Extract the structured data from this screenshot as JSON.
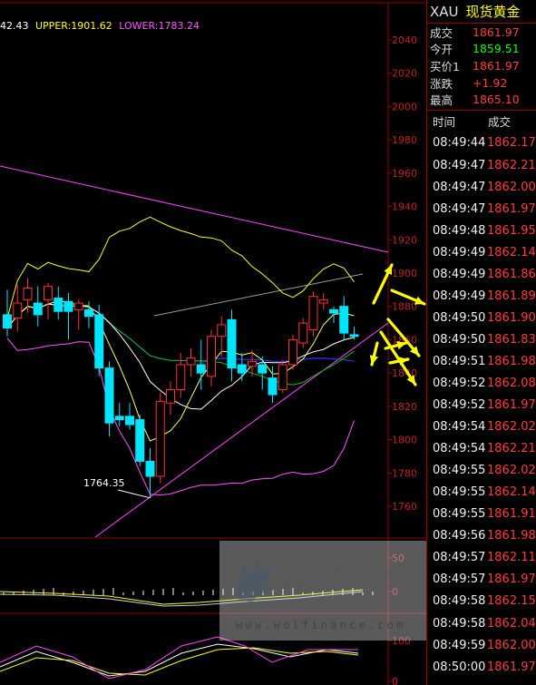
{
  "legend": {
    "mid": "42.43",
    "upper": "UPPER:1901.62",
    "lower": "LOWER:1783.24"
  },
  "panel": {
    "code": "XAU",
    "name": "现货黄金",
    "quotes": [
      {
        "label": "成交",
        "value": "1861.97",
        "color": "red"
      },
      {
        "label": "今开",
        "value": "1859.51",
        "color": "green"
      },
      {
        "label": "买价1",
        "value": "1861.97",
        "color": "red"
      },
      {
        "label": "涨跌",
        "value": "+1.92",
        "color": "red"
      },
      {
        "label": "最高",
        "value": "1865.10",
        "color": "red"
      }
    ],
    "tick_header": {
      "time": "时间",
      "price": "成交"
    },
    "ticks": [
      {
        "time": "08:49:44",
        "price": "1862.17"
      },
      {
        "time": "08:49:47",
        "price": "1862.21"
      },
      {
        "time": "08:49:47",
        "price": "1862.00"
      },
      {
        "time": "08:49:47",
        "price": "1861.97"
      },
      {
        "time": "08:49:48",
        "price": "1861.95"
      },
      {
        "time": "08:49:49",
        "price": "1862.14"
      },
      {
        "time": "08:49:49",
        "price": "1861.86"
      },
      {
        "time": "08:49:49",
        "price": "1861.89"
      },
      {
        "time": "08:49:50",
        "price": "1861.90"
      },
      {
        "time": "08:49:50",
        "price": "1861.83"
      },
      {
        "time": "08:49:51",
        "price": "1861.98"
      },
      {
        "time": "08:49:52",
        "price": "1862.08"
      },
      {
        "time": "08:49:52",
        "price": "1861.97"
      },
      {
        "time": "08:49:54",
        "price": "1862.02"
      },
      {
        "time": "08:49:54",
        "price": "1862.21"
      },
      {
        "time": "08:49:55",
        "price": "1862.02"
      },
      {
        "time": "08:49:55",
        "price": "1862.14"
      },
      {
        "time": "08:49:55",
        "price": "1861.91"
      },
      {
        "time": "08:49:56",
        "price": "1861.98"
      },
      {
        "time": "08:49:57",
        "price": "1862.11"
      },
      {
        "time": "08:49:57",
        "price": "1861.97"
      },
      {
        "time": "08:49:58",
        "price": "1862.15"
      },
      {
        "time": "08:49:58",
        "price": "1862.04"
      },
      {
        "time": "08:49:59",
        "price": "1862.00"
      },
      {
        "time": "08:50:00",
        "price": "1861.97"
      }
    ]
  },
  "chart_data": {
    "type": "candlestick",
    "y_axis": {
      "min": 1745,
      "max": 2045,
      "ticks": [
        2040,
        2020,
        2000,
        1980,
        1960,
        1940,
        1920,
        1900,
        1880,
        1860,
        1840,
        1820,
        1800,
        1780,
        1760
      ]
    },
    "low_annotation": "1764.35",
    "candles": [
      {
        "o": 1875,
        "h": 1890,
        "l": 1862,
        "c": 1867
      },
      {
        "o": 1873,
        "h": 1893,
        "l": 1865,
        "c": 1882
      },
      {
        "o": 1884,
        "h": 1897,
        "l": 1876,
        "c": 1891
      },
      {
        "o": 1882,
        "h": 1892,
        "l": 1868,
        "c": 1875
      },
      {
        "o": 1884,
        "h": 1894,
        "l": 1872,
        "c": 1892
      },
      {
        "o": 1885,
        "h": 1892,
        "l": 1872,
        "c": 1877
      },
      {
        "o": 1883,
        "h": 1888,
        "l": 1860,
        "c": 1877
      },
      {
        "o": 1878,
        "h": 1884,
        "l": 1866,
        "c": 1882
      },
      {
        "o": 1878,
        "h": 1883,
        "l": 1867,
        "c": 1874
      },
      {
        "o": 1875,
        "h": 1881,
        "l": 1838,
        "c": 1843
      },
      {
        "o": 1843,
        "h": 1847,
        "l": 1802,
        "c": 1810
      },
      {
        "o": 1814,
        "h": 1822,
        "l": 1808,
        "c": 1812
      },
      {
        "o": 1814,
        "h": 1822,
        "l": 1806,
        "c": 1809
      },
      {
        "o": 1812,
        "h": 1815,
        "l": 1784,
        "c": 1787
      },
      {
        "o": 1787,
        "h": 1795,
        "l": 1765,
        "c": 1778
      },
      {
        "o": 1778,
        "h": 1828,
        "l": 1774,
        "c": 1823
      },
      {
        "o": 1822,
        "h": 1835,
        "l": 1815,
        "c": 1830
      },
      {
        "o": 1830,
        "h": 1852,
        "l": 1825,
        "c": 1845
      },
      {
        "o": 1845,
        "h": 1855,
        "l": 1838,
        "c": 1849
      },
      {
        "o": 1845,
        "h": 1860,
        "l": 1830,
        "c": 1840
      },
      {
        "o": 1838,
        "h": 1866,
        "l": 1832,
        "c": 1862
      },
      {
        "o": 1862,
        "h": 1874,
        "l": 1850,
        "c": 1869
      },
      {
        "o": 1872,
        "h": 1878,
        "l": 1835,
        "c": 1843
      },
      {
        "o": 1845,
        "h": 1852,
        "l": 1835,
        "c": 1840
      },
      {
        "o": 1844,
        "h": 1854,
        "l": 1838,
        "c": 1847
      },
      {
        "o": 1845,
        "h": 1850,
        "l": 1830,
        "c": 1840
      },
      {
        "o": 1837,
        "h": 1844,
        "l": 1822,
        "c": 1827
      },
      {
        "o": 1830,
        "h": 1848,
        "l": 1828,
        "c": 1845
      },
      {
        "o": 1845,
        "h": 1863,
        "l": 1842,
        "c": 1860
      },
      {
        "o": 1858,
        "h": 1873,
        "l": 1855,
        "c": 1870
      },
      {
        "o": 1866,
        "h": 1889,
        "l": 1862,
        "c": 1886
      },
      {
        "o": 1882,
        "h": 1888,
        "l": 1878,
        "c": 1884
      },
      {
        "o": 1878,
        "h": 1880,
        "l": 1870,
        "c": 1876
      },
      {
        "o": 1880,
        "h": 1886,
        "l": 1860,
        "c": 1864
      },
      {
        "o": 1863,
        "h": 1868,
        "l": 1860,
        "c": 1862
      }
    ],
    "colors": {
      "up": "#ff3030",
      "down": "#00e5ff",
      "upper_band": "#ffff00",
      "lower_band": "#ff55ff",
      "mid_band": "#ffffff",
      "ma_blue": "#3333ff",
      "ma_green": "#00c000",
      "trendline": "#ff44ff",
      "axis": "#9a0000",
      "axis_label": "#c02020",
      "arrow": "#ffff00"
    },
    "sub1_axis": {
      "ticks": [
        50,
        0
      ]
    },
    "sub2_axis": {
      "ticks": [
        100,
        0
      ]
    }
  }
}
